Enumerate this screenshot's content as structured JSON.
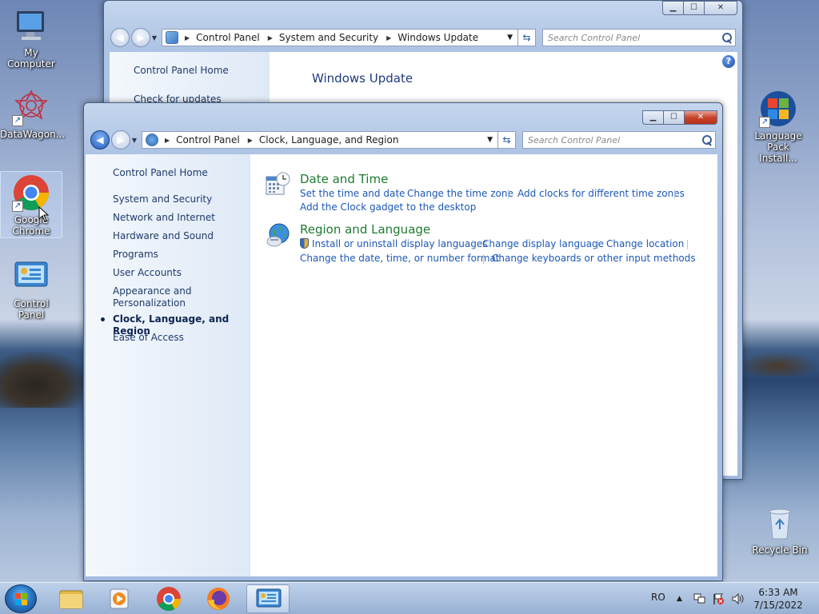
{
  "desktop": {
    "icons": [
      {
        "label": "My Computer",
        "icon": "computer-icon"
      },
      {
        "label": "DataWagon...",
        "icon": "datawagon-icon"
      },
      {
        "label": "Google Chrome",
        "icon": "chrome-icon"
      },
      {
        "label": "Control Panel",
        "icon": "control-panel-icon"
      },
      {
        "label": "Language Pack Install...",
        "icon": "language-pack-icon"
      },
      {
        "label": "Recycle Bin",
        "icon": "recycle-bin-icon"
      }
    ]
  },
  "back_window": {
    "breadcrumb": [
      "Control Panel",
      "System and Security",
      "Windows Update"
    ],
    "search_placeholder": "Search Control Panel",
    "sidebar": [
      "Control Panel Home",
      "Check for updates"
    ],
    "heading": "Windows Update"
  },
  "front_window": {
    "breadcrumb": [
      "Control Panel",
      "Clock, Language, and Region"
    ],
    "search_placeholder": "Search Control Panel",
    "sidebar": [
      "Control Panel Home",
      "System and Security",
      "Network and Internet",
      "Hardware and Sound",
      "Programs",
      "User Accounts",
      "Appearance and",
      "Personalization",
      "Clock, Language, and Region",
      "Ease of Access"
    ],
    "categories": [
      {
        "title": "Date and Time",
        "icon": "calendar-clock-icon",
        "links": [
          "Set the time and date",
          "Change the time zone",
          "Add clocks for different time zones",
          "Add the Clock gadget to the desktop"
        ]
      },
      {
        "title": "Region and Language",
        "icon": "globe-icon",
        "links": [
          "Install or uninstall display languages",
          "Change display language",
          "Change location",
          "Change the date, time, or number format",
          "Change keyboards or other input methods"
        ]
      }
    ]
  },
  "taskbar": {
    "pinned": [
      "file-explorer-icon",
      "media-player-icon",
      "chrome-icon",
      "firefox-icon",
      "control-panel-icon"
    ],
    "language": "RO",
    "time": "6:33 AM",
    "date": "7/15/2022"
  }
}
